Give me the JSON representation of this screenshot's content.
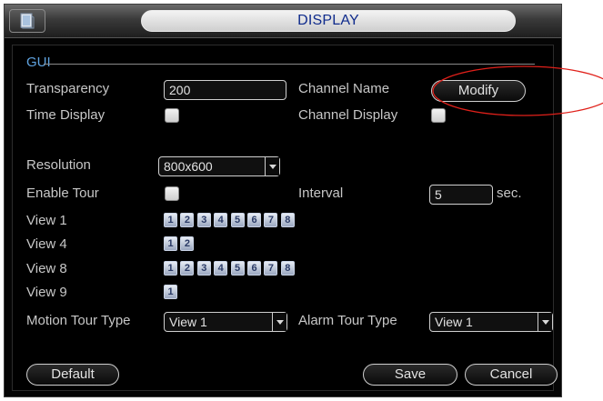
{
  "window": {
    "title": "DISPLAY",
    "title_icon": "monitor-icon"
  },
  "gui": {
    "section_label": "GUI",
    "transparency": {
      "label": "Transparency",
      "value": "200"
    },
    "channel_name": {
      "label": "Channel Name",
      "button": "Modify"
    },
    "time_display": {
      "label": "Time Display",
      "checked": true
    },
    "channel_display": {
      "label": "Channel Display",
      "checked": true
    }
  },
  "resolution": {
    "label": "Resolution",
    "value": "800x600"
  },
  "tour": {
    "enable_label": "Enable Tour",
    "enabled": true,
    "interval_label": "Interval",
    "interval_value": "5",
    "interval_unit": "sec."
  },
  "views": [
    {
      "label": "View 1",
      "channels": [
        "1",
        "2",
        "3",
        "4",
        "5",
        "6",
        "7",
        "8"
      ]
    },
    {
      "label": "View 4",
      "channels": [
        "1",
        "2"
      ]
    },
    {
      "label": "View 8",
      "channels": [
        "1",
        "2",
        "3",
        "4",
        "5",
        "6",
        "7",
        "8"
      ]
    },
    {
      "label": "View 9",
      "channels": [
        "1"
      ]
    }
  ],
  "motion_tour": {
    "label": "Motion Tour Type",
    "value": "View 1"
  },
  "alarm_tour": {
    "label": "Alarm Tour Type",
    "value": "View 1"
  },
  "buttons": {
    "default": "Default",
    "save": "Save",
    "cancel": "Cancel"
  },
  "colors": {
    "annotation": "#e0201a",
    "title_text": "#0f2b8c",
    "gui_label": "#5fa3e0"
  }
}
